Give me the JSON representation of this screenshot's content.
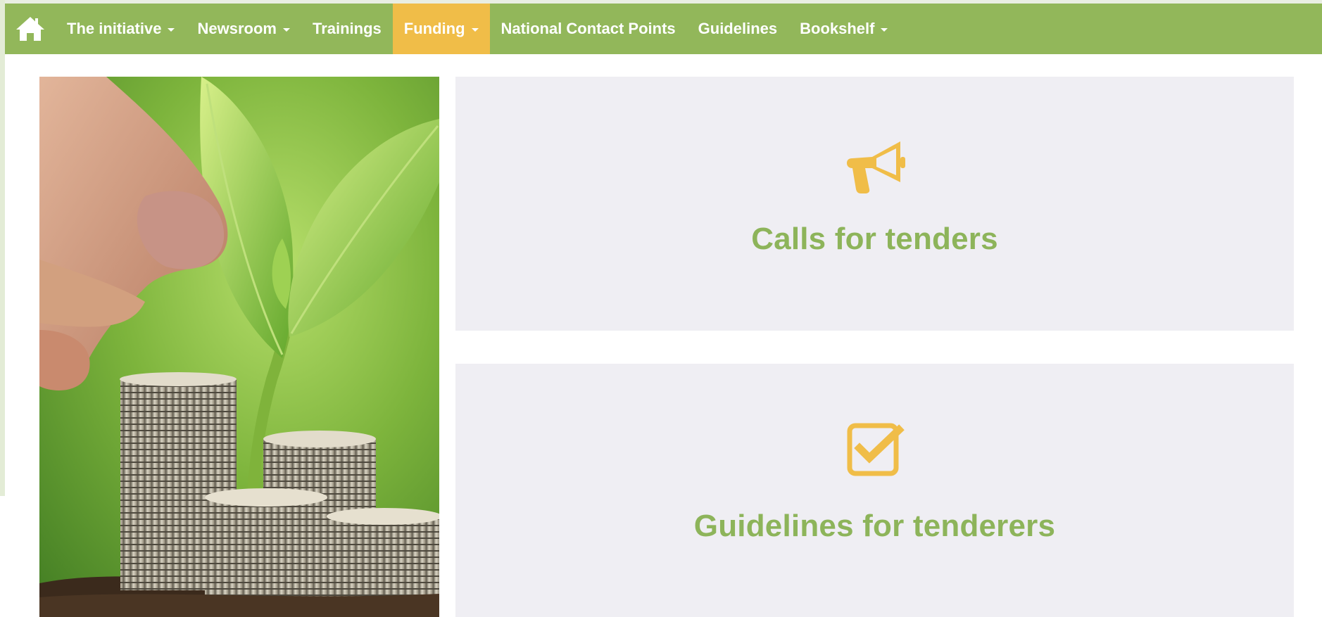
{
  "colors": {
    "nav_background": "#92b75a",
    "nav_active": "#f0bd48",
    "card_background": "#efeef3",
    "card_title": "#8db45a",
    "icon_accent": "#f0bd48"
  },
  "navbar": {
    "home_icon": "home-icon",
    "items": [
      {
        "label": "The initiative",
        "dropdown": true,
        "active": false
      },
      {
        "label": "Newsroom",
        "dropdown": true,
        "active": false
      },
      {
        "label": "Trainings",
        "dropdown": false,
        "active": false
      },
      {
        "label": "Funding",
        "dropdown": true,
        "active": true
      },
      {
        "label": "National Contact Points",
        "dropdown": false,
        "active": false
      },
      {
        "label": "Guidelines",
        "dropdown": false,
        "active": false
      },
      {
        "label": "Bookshelf",
        "dropdown": true,
        "active": false
      }
    ]
  },
  "hero": {
    "image": "plant-and-coins-photo"
  },
  "cards": [
    {
      "icon": "megaphone-icon",
      "title": "Calls for tenders"
    },
    {
      "icon": "checkbox-check-icon",
      "title": "Guidelines for tenderers"
    }
  ]
}
